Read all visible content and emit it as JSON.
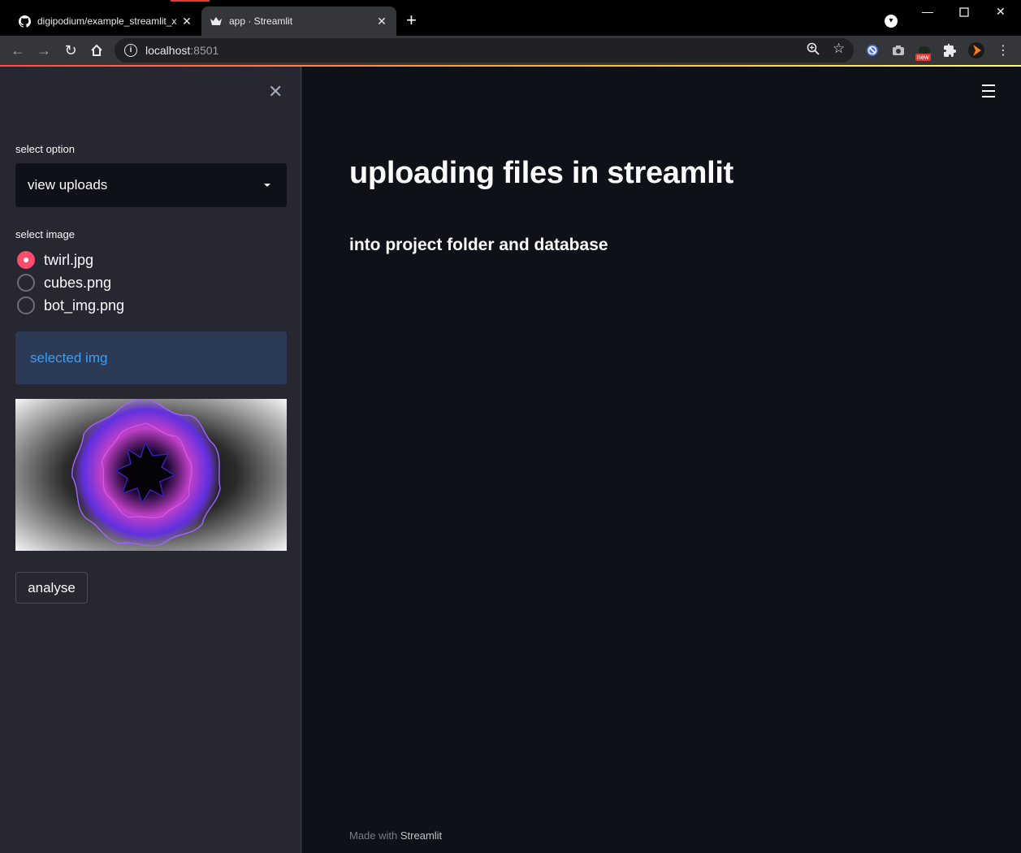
{
  "browser": {
    "tabs": [
      {
        "title": "digipodium/example_streamlit_x",
        "icon": "github-icon"
      },
      {
        "title": "app · Streamlit",
        "icon": "streamlit-crown-icon"
      }
    ],
    "url": {
      "host": "localhost",
      "port": ":8501"
    },
    "extension_badge": "new"
  },
  "sidebar": {
    "select_label": "select option",
    "select_value": "view uploads",
    "radio_label": "select image",
    "radio_options": [
      {
        "label": "twirl.jpg",
        "checked": true
      },
      {
        "label": "cubes.png",
        "checked": false
      },
      {
        "label": "bot_img.png",
        "checked": false
      }
    ],
    "info_text": "selected img",
    "button_label": "analyse"
  },
  "main": {
    "title": "uploading files in streamlit",
    "subtitle": "into project folder and database",
    "footer_prefix": "Made with ",
    "footer_brand": "Streamlit"
  },
  "colors": {
    "accent": "#ff4b6e",
    "info_text": "#3d9df6",
    "sidebar_bg": "#262730",
    "main_bg": "#0e1117"
  }
}
